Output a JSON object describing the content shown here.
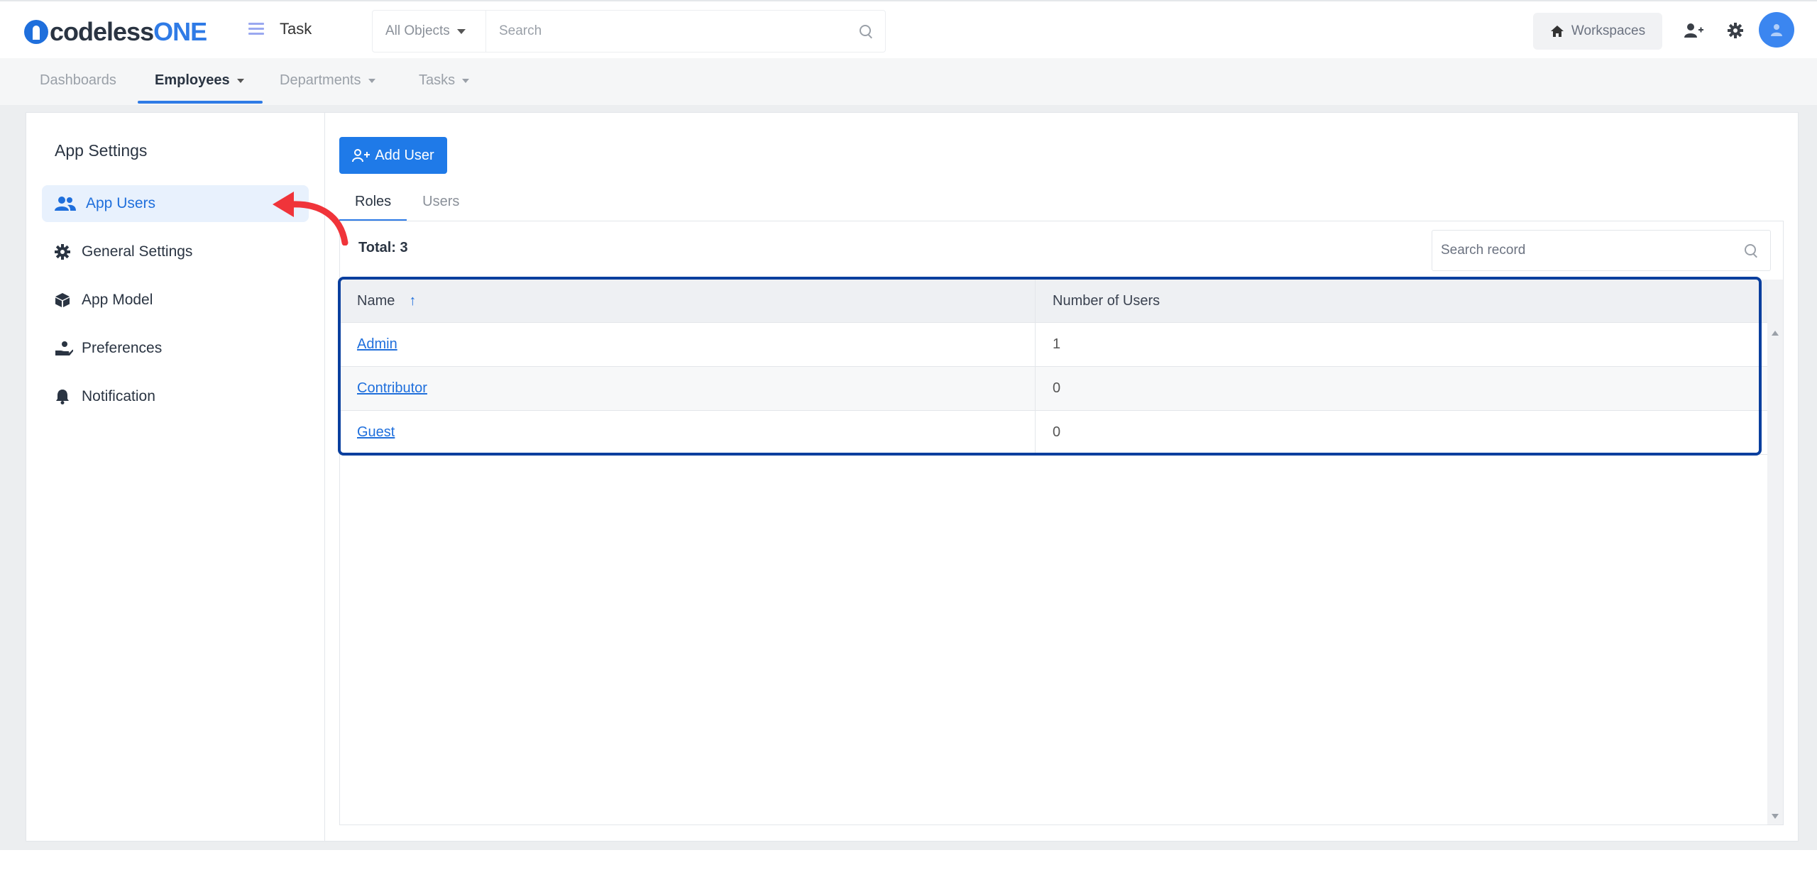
{
  "header": {
    "logo": {
      "part1": "codeless",
      "part2": "ONE"
    },
    "app_name": "Task",
    "object_select": "All Objects",
    "search_placeholder": "Search",
    "workspaces_label": "Workspaces"
  },
  "nav": {
    "items": [
      {
        "label": "Dashboards"
      },
      {
        "label": "Employees"
      },
      {
        "label": "Departments"
      },
      {
        "label": "Tasks"
      }
    ],
    "active": "Employees"
  },
  "sidebar": {
    "title": "App Settings",
    "items": [
      {
        "label": "App Users",
        "icon": "users-icon",
        "active": true
      },
      {
        "label": "General Settings",
        "icon": "gear-icon"
      },
      {
        "label": "App Model",
        "icon": "cube-icon"
      },
      {
        "label": "Preferences",
        "icon": "hand-icon"
      },
      {
        "label": "Notification",
        "icon": "bell-icon"
      }
    ]
  },
  "main": {
    "add_user_label": "Add User",
    "tabs": [
      {
        "label": "Roles",
        "active": true
      },
      {
        "label": "Users"
      }
    ],
    "total_label": "Total: 3",
    "search_placeholder": "Search record",
    "table": {
      "columns": [
        "Name",
        "Number of Users"
      ],
      "rows": [
        {
          "name": "Admin",
          "count": "1"
        },
        {
          "name": "Contributor",
          "count": "0"
        },
        {
          "name": "Guest",
          "count": "0"
        }
      ]
    }
  },
  "colors": {
    "primary": "#1f7ae8",
    "highlight_border": "#0a3f9e",
    "annotation_arrow": "#f0343a",
    "active_bg": "#e8f1fd"
  }
}
